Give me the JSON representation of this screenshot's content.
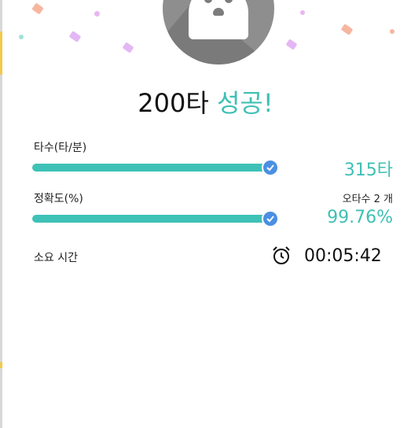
{
  "result": {
    "title_main": "200타",
    "title_status": "성공!"
  },
  "stats": {
    "speed": {
      "label": "타수(타/분)",
      "value": "315타",
      "progress": 1.0
    },
    "accuracy": {
      "label": "정확도(%)",
      "typo_count_text": "오타수 2 개",
      "value": "99.76%",
      "progress": 1.0
    },
    "time": {
      "label": "소요 시간",
      "value": "00:05:42"
    }
  },
  "icons": {
    "avatar": "ghost-avatar-icon",
    "check": "check-circle-icon",
    "clock": "alarm-clock-icon"
  },
  "colors": {
    "accent": "#3fc0b4",
    "bar": "#3ec1b6",
    "check": "#4a8fe3",
    "avatar_bg": "#8e8e8e"
  }
}
